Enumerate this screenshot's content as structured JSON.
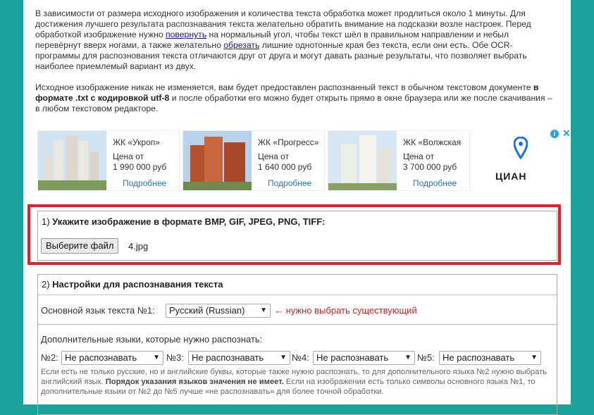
{
  "intro": {
    "p1_part1": "В зависимости от размера исходного изображения и количества текста обработка может продлиться около 1 минуты. Для достижения лучшего результата распознавания текста желательно обратить внимание на подсказки возле настроек. Перед обработкой изображение нужно ",
    "p1_link1": "повернуть",
    "p1_part2": " на нормальный угол, чтобы текст шёл в правильном направлении и небыл перевёрнут вверх ногами, а также желательно ",
    "p1_link2": "обрезать",
    "p1_part3": " лишние однотонные края без текста, если они есть. Обе OCR-программы для распознования текста отличаются друг от друга и могут давать разные результаты, что позволяет выбрать наиболее приемлемый вариант из двух.",
    "p2_part1": "Исходное изображение никак не изменяется, вам будет предоставлен распознанный текст в обычном текстовом документе ",
    "p2_bold": "в формате .txt с кодировкой utf-8",
    "p2_part2": " и после обработки его можно будет открыть прямо в окне браузера или же после скачивания – в любом текстовом редакторе."
  },
  "ads": [
    {
      "name": "ЖК «Укроп»",
      "price_label": "Цена от",
      "price": "1 990 000 руб",
      "more": "Подробнее"
    },
    {
      "name": "ЖК «Прогресс»",
      "price_label": "Цена от",
      "price": "1 640 000 руб",
      "more": "Подробнее"
    },
    {
      "name": "ЖК «Волжская ...",
      "price_label": "Цена от",
      "price": "3 700 000 руб",
      "more": "Подробнее"
    }
  ],
  "cian_logo": "ЦИАН",
  "adchoices": "i",
  "adclose": "✕",
  "section1": {
    "number": "1) ",
    "title": "Укажите изображение в формате BMP, GIF, JPEG, PNG, TIFF:",
    "button": "Выберите файл",
    "file": "4.jpg"
  },
  "section2": {
    "number": "2) ",
    "title": "Настройки для распознавания текста",
    "main_lang_label": "Основной язык текста №1:",
    "main_lang_value": "Русский (Russian)",
    "main_lang_hint": "← нужно выбрать существующий",
    "extra_label": "Дополнительные языки, которые нужно распознать:",
    "extra": [
      {
        "label": "№2:",
        "value": "Не распознавать"
      },
      {
        "label": "№3:",
        "value": "Не распознавать"
      },
      {
        "label": "№4:",
        "value": "Не распознавать"
      },
      {
        "label": "№5:",
        "value": "Не распознавать"
      }
    ],
    "note_part1": "Если есть не только русские, но и английские буквы, которые также нужно распознать, то для дополнительного языка №2 нужно выбрать английский язык. ",
    "note_bold": "Порядок указания языков значения не имеет.",
    "note_part2": " Если на изображении есть только символы основного языка №1, то дополнительные языки от №2 до №5 лучше «не распознавать» для более точной обработки."
  },
  "colors": {
    "background": "#1aa39a",
    "highlight": "#e0202b",
    "hint": "#d62020",
    "link": "#1a0dab"
  }
}
